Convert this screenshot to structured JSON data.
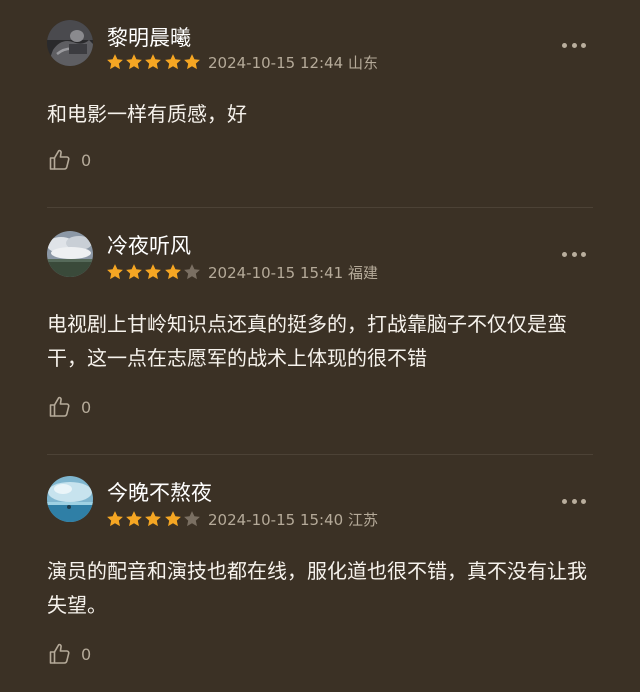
{
  "comments": [
    {
      "username": "黎明晨曦",
      "rating": 5,
      "datetime": "2024-10-15 12:44",
      "location": "山东",
      "content": "和电影一样有质感，好",
      "likes": "0",
      "avatar_icon": "avatar-photo-dark"
    },
    {
      "username": "冷夜听风",
      "rating": 4,
      "datetime": "2024-10-15 15:41",
      "location": "福建",
      "content": "电视剧上甘岭知识点还真的挺多的，打战靠脑子不仅仅是蛮干，这一点在志愿军的战术上体现的很不错",
      "likes": "0",
      "avatar_icon": "avatar-photo-clouds"
    },
    {
      "username": "今晚不熬夜",
      "rating": 4,
      "datetime": "2024-10-15 15:40",
      "location": "江苏",
      "content": "演员的配音和演技也都在线，服化道也很不错，真不没有让我失望。",
      "likes": "0",
      "avatar_icon": "avatar-photo-sea"
    }
  ],
  "colors": {
    "background": "#3b3125",
    "star_filled": "#f5a623",
    "star_empty": "#7a6f62",
    "meta_text": "#b5aa99"
  }
}
